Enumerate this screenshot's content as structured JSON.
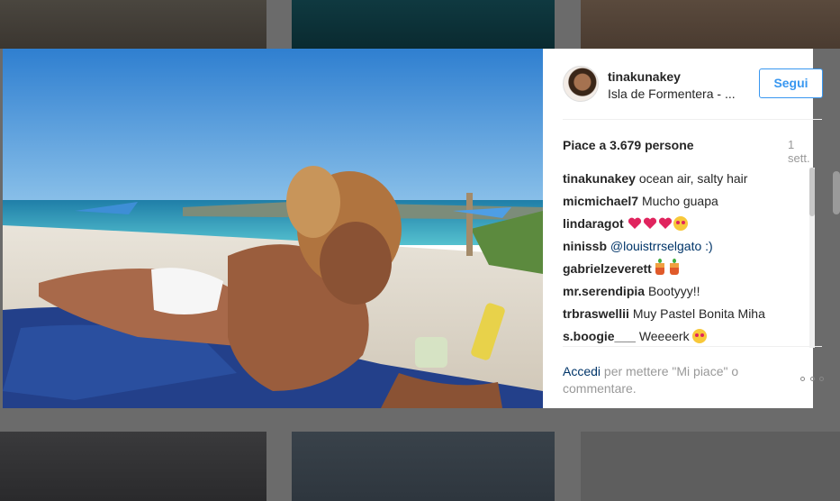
{
  "post": {
    "username": "tinakunakey",
    "location": "Isla de Formentera - ...",
    "follow_label": "Segui",
    "likes": "Piace a 3.679 persone",
    "time": "1 sett."
  },
  "comments": [
    {
      "user": "tinakunakey",
      "text": "ocean air, salty hair"
    },
    {
      "user": "micmichael7",
      "text": "Mucho guapa"
    },
    {
      "user": "lindaragot",
      "text": ""
    },
    {
      "user": "ninissb",
      "text": "@louistrrselgato :)"
    },
    {
      "user": "gabrielzeverett",
      "text": ""
    },
    {
      "user": "mr.serendipia",
      "text": "Bootyyy!!"
    },
    {
      "user": "trbraswellii",
      "text": "Muy Pastel Bonita Miha"
    },
    {
      "user": "s.boogie___",
      "text": "Weeeerk"
    }
  ],
  "footer": {
    "login_link": "Accedi",
    "login_rest": " per mettere \"Mi piace\" o commentare."
  },
  "colors": {
    "accent": "#3897f0",
    "link": "#003569",
    "text": "#262626",
    "muted": "#999999"
  }
}
